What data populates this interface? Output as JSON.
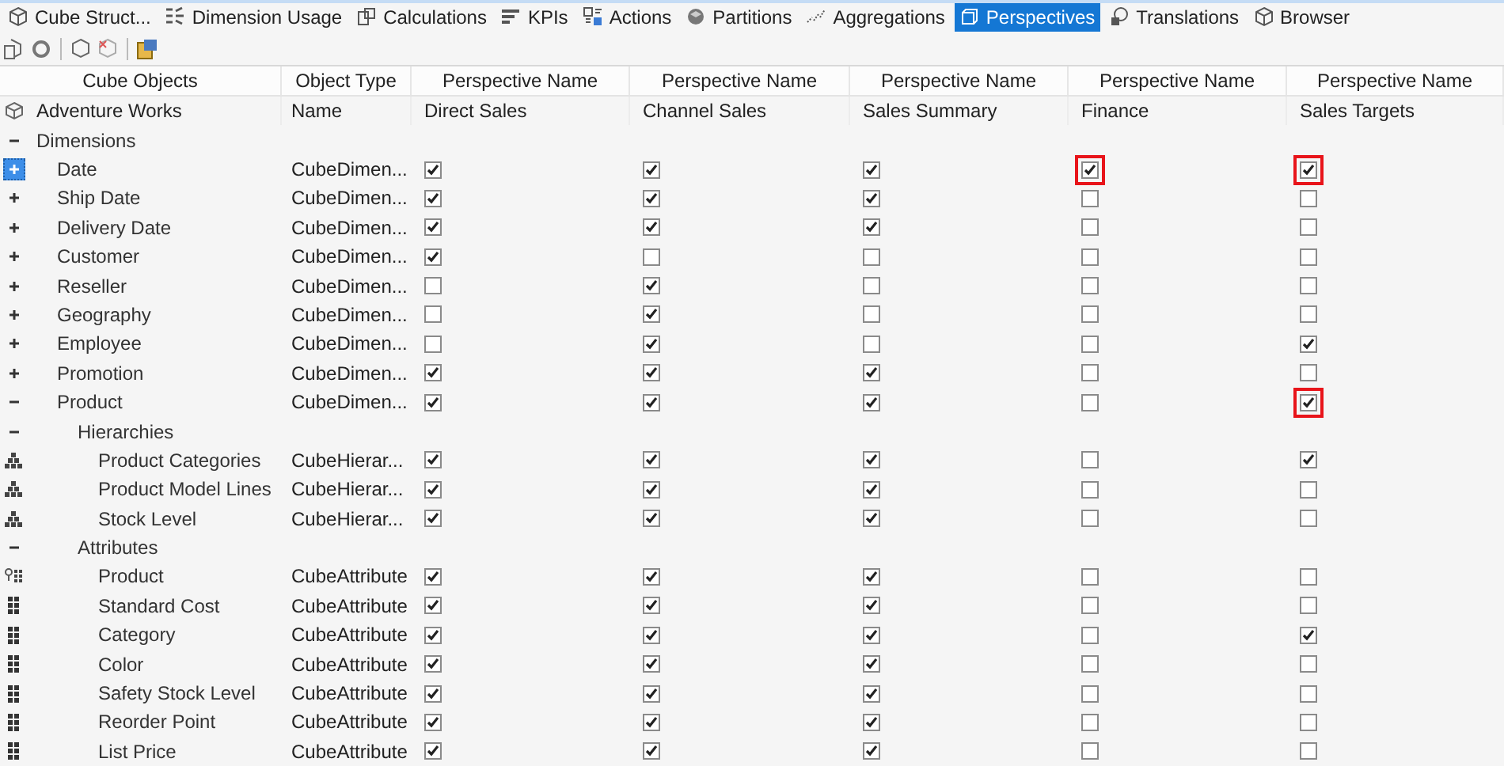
{
  "tabs": [
    {
      "label": "Cube Struct...",
      "selected": false
    },
    {
      "label": "Dimension Usage",
      "selected": false
    },
    {
      "label": "Calculations",
      "selected": false
    },
    {
      "label": "KPIs",
      "selected": false
    },
    {
      "label": "Actions",
      "selected": false
    },
    {
      "label": "Partitions",
      "selected": false
    },
    {
      "label": "Aggregations",
      "selected": false
    },
    {
      "label": "Perspectives",
      "selected": true
    },
    {
      "label": "Translations",
      "selected": false
    },
    {
      "label": "Browser",
      "selected": false
    }
  ],
  "table": {
    "columns": [
      "Cube Objects",
      "Object Type",
      "Perspective Name",
      "Perspective Name",
      "Perspective Name",
      "Perspective Name",
      "Perspective Name"
    ],
    "cube": {
      "name": "Adventure Works",
      "type": "Name",
      "perspectives": [
        "Direct Sales",
        "Channel Sales",
        "Sales Summary",
        "Finance",
        "Sales Targets"
      ]
    },
    "rows": [
      {
        "kind": "folder",
        "label": "Dimensions",
        "expanded": true,
        "children": [
          {
            "kind": "dimension",
            "label": "Date",
            "type": "CubeDimen...",
            "expanded": false,
            "selected": true,
            "checks": [
              {
                "checked": true,
                "highlighted": false
              },
              {
                "checked": true,
                "highlighted": false
              },
              {
                "checked": true,
                "highlighted": false
              },
              {
                "checked": true,
                "highlighted": true
              },
              {
                "checked": true,
                "highlighted": true
              }
            ]
          },
          {
            "kind": "dimension",
            "label": "Ship Date",
            "type": "CubeDimen...",
            "expanded": false,
            "selected": false,
            "checks": [
              {
                "checked": true,
                "highlighted": false
              },
              {
                "checked": true,
                "highlighted": false
              },
              {
                "checked": true,
                "highlighted": false
              },
              {
                "checked": false,
                "highlighted": false
              },
              {
                "checked": false,
                "highlighted": false
              }
            ]
          },
          {
            "kind": "dimension",
            "label": "Delivery Date",
            "type": "CubeDimen...",
            "expanded": false,
            "selected": false,
            "checks": [
              {
                "checked": true,
                "highlighted": false
              },
              {
                "checked": true,
                "highlighted": false
              },
              {
                "checked": true,
                "highlighted": false
              },
              {
                "checked": false,
                "highlighted": false
              },
              {
                "checked": false,
                "highlighted": false
              }
            ]
          },
          {
            "kind": "dimension",
            "label": "Customer",
            "type": "CubeDimen...",
            "expanded": false,
            "selected": false,
            "checks": [
              {
                "checked": true,
                "highlighted": false
              },
              {
                "checked": false,
                "highlighted": false
              },
              {
                "checked": false,
                "highlighted": false
              },
              {
                "checked": false,
                "highlighted": false
              },
              {
                "checked": false,
                "highlighted": false
              }
            ]
          },
          {
            "kind": "dimension",
            "label": "Reseller",
            "type": "CubeDimen...",
            "expanded": false,
            "selected": false,
            "checks": [
              {
                "checked": false,
                "highlighted": false
              },
              {
                "checked": true,
                "highlighted": false
              },
              {
                "checked": false,
                "highlighted": false
              },
              {
                "checked": false,
                "highlighted": false
              },
              {
                "checked": false,
                "highlighted": false
              }
            ]
          },
          {
            "kind": "dimension",
            "label": "Geography",
            "type": "CubeDimen...",
            "expanded": false,
            "selected": false,
            "checks": [
              {
                "checked": false,
                "highlighted": false
              },
              {
                "checked": true,
                "highlighted": false
              },
              {
                "checked": false,
                "highlighted": false
              },
              {
                "checked": false,
                "highlighted": false
              },
              {
                "checked": false,
                "highlighted": false
              }
            ]
          },
          {
            "kind": "dimension",
            "label": "Employee",
            "type": "CubeDimen...",
            "expanded": false,
            "selected": false,
            "checks": [
              {
                "checked": false,
                "highlighted": false
              },
              {
                "checked": true,
                "highlighted": false
              },
              {
                "checked": false,
                "highlighted": false
              },
              {
                "checked": false,
                "highlighted": false
              },
              {
                "checked": true,
                "highlighted": false
              }
            ]
          },
          {
            "kind": "dimension",
            "label": "Promotion",
            "type": "CubeDimen...",
            "expanded": false,
            "selected": false,
            "checks": [
              {
                "checked": true,
                "highlighted": false
              },
              {
                "checked": true,
                "highlighted": false
              },
              {
                "checked": true,
                "highlighted": false
              },
              {
                "checked": false,
                "highlighted": false
              },
              {
                "checked": false,
                "highlighted": false
              }
            ]
          },
          {
            "kind": "dimension",
            "label": "Product",
            "type": "CubeDimen...",
            "expanded": true,
            "selected": false,
            "checks": [
              {
                "checked": true,
                "highlighted": false
              },
              {
                "checked": true,
                "highlighted": false
              },
              {
                "checked": true,
                "highlighted": false
              },
              {
                "checked": false,
                "highlighted": false
              },
              {
                "checked": true,
                "highlighted": true
              }
            ],
            "children": [
              {
                "kind": "folder",
                "label": "Hierarchies",
                "expanded": true,
                "children": [
                  {
                    "kind": "hierarchy",
                    "label": "Product Categories",
                    "type": "CubeHierar...",
                    "checks": [
                      {
                        "checked": true,
                        "highlighted": false
                      },
                      {
                        "checked": true,
                        "highlighted": false
                      },
                      {
                        "checked": true,
                        "highlighted": false
                      },
                      {
                        "checked": false,
                        "highlighted": false
                      },
                      {
                        "checked": true,
                        "highlighted": false
                      }
                    ]
                  },
                  {
                    "kind": "hierarchy",
                    "label": "Product Model Lines",
                    "type": "CubeHierar...",
                    "checks": [
                      {
                        "checked": true,
                        "highlighted": false
                      },
                      {
                        "checked": true,
                        "highlighted": false
                      },
                      {
                        "checked": true,
                        "highlighted": false
                      },
                      {
                        "checked": false,
                        "highlighted": false
                      },
                      {
                        "checked": false,
                        "highlighted": false
                      }
                    ]
                  },
                  {
                    "kind": "hierarchy",
                    "label": "Stock Level",
                    "type": "CubeHierar...",
                    "checks": [
                      {
                        "checked": true,
                        "highlighted": false
                      },
                      {
                        "checked": true,
                        "highlighted": false
                      },
                      {
                        "checked": true,
                        "highlighted": false
                      },
                      {
                        "checked": false,
                        "highlighted": false
                      },
                      {
                        "checked": false,
                        "highlighted": false
                      }
                    ]
                  }
                ]
              },
              {
                "kind": "folder",
                "label": "Attributes",
                "expanded": true,
                "children": [
                  {
                    "kind": "key-attribute",
                    "label": "Product",
                    "type": "CubeAttribute",
                    "checks": [
                      {
                        "checked": true,
                        "highlighted": false
                      },
                      {
                        "checked": true,
                        "highlighted": false
                      },
                      {
                        "checked": true,
                        "highlighted": false
                      },
                      {
                        "checked": false,
                        "highlighted": false
                      },
                      {
                        "checked": false,
                        "highlighted": false
                      }
                    ]
                  },
                  {
                    "kind": "attribute",
                    "label": "Standard Cost",
                    "type": "CubeAttribute",
                    "checks": [
                      {
                        "checked": true,
                        "highlighted": false
                      },
                      {
                        "checked": true,
                        "highlighted": false
                      },
                      {
                        "checked": true,
                        "highlighted": false
                      },
                      {
                        "checked": false,
                        "highlighted": false
                      },
                      {
                        "checked": false,
                        "highlighted": false
                      }
                    ]
                  },
                  {
                    "kind": "attribute",
                    "label": "Category",
                    "type": "CubeAttribute",
                    "checks": [
                      {
                        "checked": true,
                        "highlighted": false
                      },
                      {
                        "checked": true,
                        "highlighted": false
                      },
                      {
                        "checked": true,
                        "highlighted": false
                      },
                      {
                        "checked": false,
                        "highlighted": false
                      },
                      {
                        "checked": true,
                        "highlighted": false
                      }
                    ]
                  },
                  {
                    "kind": "attribute",
                    "label": "Color",
                    "type": "CubeAttribute",
                    "checks": [
                      {
                        "checked": true,
                        "highlighted": false
                      },
                      {
                        "checked": true,
                        "highlighted": false
                      },
                      {
                        "checked": true,
                        "highlighted": false
                      },
                      {
                        "checked": false,
                        "highlighted": false
                      },
                      {
                        "checked": false,
                        "highlighted": false
                      }
                    ]
                  },
                  {
                    "kind": "attribute",
                    "label": "Safety Stock Level",
                    "type": "CubeAttribute",
                    "checks": [
                      {
                        "checked": true,
                        "highlighted": false
                      },
                      {
                        "checked": true,
                        "highlighted": false
                      },
                      {
                        "checked": true,
                        "highlighted": false
                      },
                      {
                        "checked": false,
                        "highlighted": false
                      },
                      {
                        "checked": false,
                        "highlighted": false
                      }
                    ]
                  },
                  {
                    "kind": "attribute",
                    "label": "Reorder Point",
                    "type": "CubeAttribute",
                    "checks": [
                      {
                        "checked": true,
                        "highlighted": false
                      },
                      {
                        "checked": true,
                        "highlighted": false
                      },
                      {
                        "checked": true,
                        "highlighted": false
                      },
                      {
                        "checked": false,
                        "highlighted": false
                      },
                      {
                        "checked": false,
                        "highlighted": false
                      }
                    ]
                  },
                  {
                    "kind": "attribute",
                    "label": "List Price",
                    "type": "CubeAttribute",
                    "checks": [
                      {
                        "checked": true,
                        "highlighted": false
                      },
                      {
                        "checked": true,
                        "highlighted": false
                      },
                      {
                        "checked": true,
                        "highlighted": false
                      },
                      {
                        "checked": false,
                        "highlighted": false
                      },
                      {
                        "checked": false,
                        "highlighted": false
                      }
                    ]
                  }
                ]
              }
            ]
          }
        ]
      }
    ]
  }
}
